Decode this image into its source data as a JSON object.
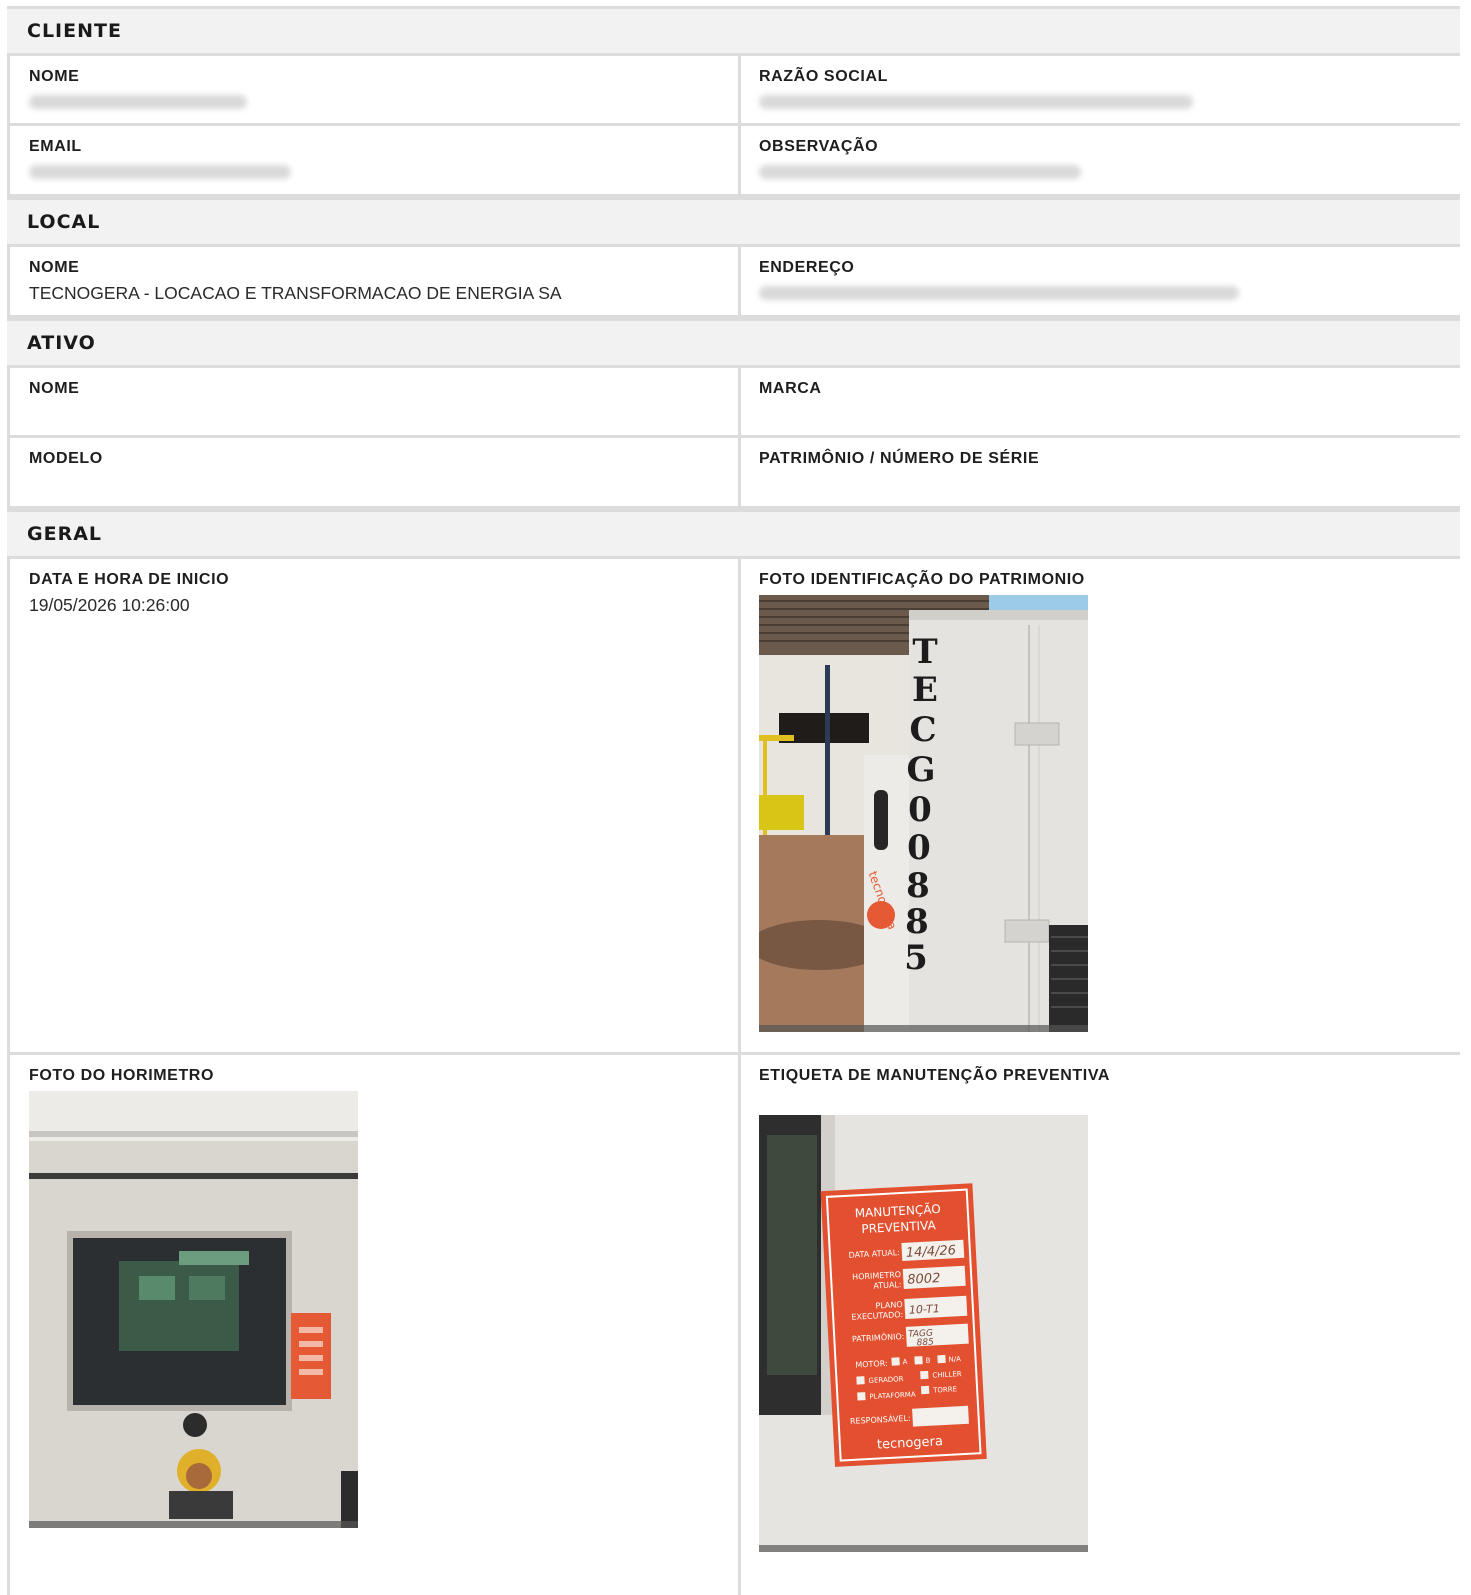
{
  "cliente": {
    "title": "CLIENTE",
    "nome_label": "NOME",
    "razao_label": "RAZÃO SOCIAL",
    "email_label": "EMAIL",
    "observacao_label": "OBSERVAÇÃO"
  },
  "local": {
    "title": "LOCAL",
    "nome_label": "NOME",
    "nome_value": "TECNOGERA - LOCACAO E TRANSFORMACAO DE ENERGIA SA",
    "endereco_label": "ENDEREÇO"
  },
  "ativo": {
    "title": "ATIVO",
    "nome_label": "NOME",
    "marca_label": "MARCA",
    "modelo_label": "MODELO",
    "patrimonio_label": "PATRIMÔNIO / NÚMERO DE SÉRIE"
  },
  "geral": {
    "title": "GERAL",
    "data_label": "DATA E HORA DE INICIO",
    "data_value": "19/05/2026 10:26:00",
    "foto_patrimonio_label": "FOTO IDENTIFICAÇÃO DO PATRIMONIO",
    "foto_horimetro_label": "FOTO DO HORIMETRO",
    "etiqueta_label": "ETIQUETA DE MANUTENÇÃO PREVENTIVA"
  },
  "photo1": {
    "stencil": [
      "T",
      "E",
      "C",
      "G",
      "0",
      "0",
      "8",
      "8",
      "5"
    ],
    "brand": "tecnogera"
  },
  "photo3": {
    "tag_title_1": "MANUTENÇÃO",
    "tag_title_2": "PREVENTIVA",
    "f_data_atual": "DATA ATUAL:",
    "v_data_atual": "14/4/26",
    "f_horimetro_1": "HORIMETRO",
    "f_horimetro_2": "ATUAL:",
    "v_horimetro": "8002",
    "f_plano_1": "PLANO",
    "f_plano_2": "EXECUTADO:",
    "v_plano": "10-T1",
    "f_patrimonio": "PATRIMÔNIO:",
    "v_patrimonio_1": "TAGG",
    "v_patrimonio_2": "885",
    "f_motor": "MOTOR:",
    "opt_a": "A",
    "opt_b": "B",
    "opt_na": "N/A",
    "opt_gerador": "GERADOR",
    "opt_chiller": "CHILLER",
    "opt_plataforma": "PLATAFORMA",
    "opt_torre": "TORRE",
    "f_responsavel": "RESPONSÁVEL:",
    "brand": "tecnogera"
  }
}
